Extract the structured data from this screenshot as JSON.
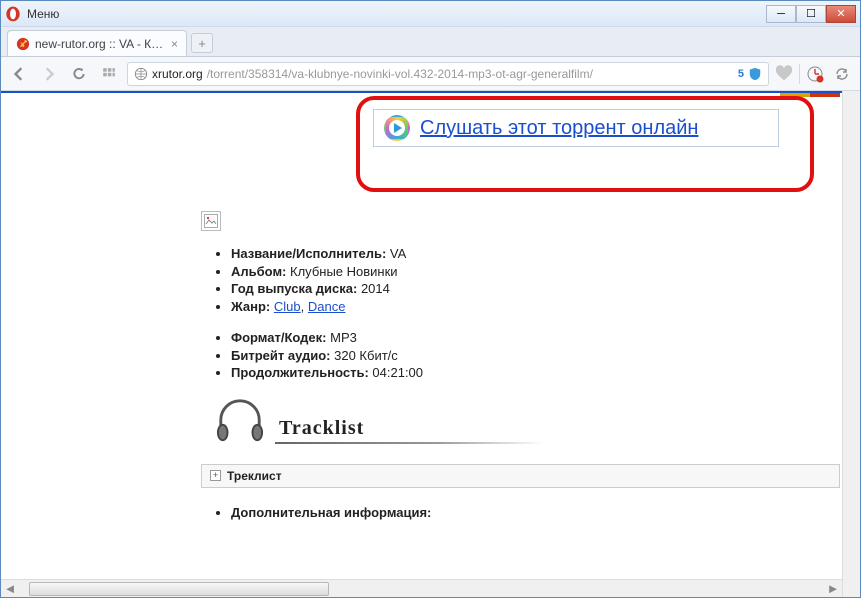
{
  "window": {
    "menu_label": "Меню"
  },
  "tab": {
    "title": "new-rutor.org :: VA - Клуб"
  },
  "address": {
    "host": "xrutor.org",
    "path": "/torrent/358314/va-klubnye-novinki-vol.432-2014-mp3-ot-agr-generalfilm/",
    "badge_count": "5"
  },
  "callout": {
    "listen_label": "Слушать этот торрент онлайн"
  },
  "info1": [
    {
      "label": "Название/Исполнитель:",
      "value": "VA"
    },
    {
      "label": "Альбом:",
      "value": "Клубные Новинки"
    },
    {
      "label": "Год выпуска диска:",
      "value": "2014"
    },
    {
      "label": "Жанр:",
      "links": [
        "Club",
        "Dance"
      ]
    }
  ],
  "info2": [
    {
      "label": "Формат/Кодек:",
      "value": "MP3"
    },
    {
      "label": "Битрейт аудио:",
      "value": "320 Кбит/с"
    },
    {
      "label": "Продолжительность:",
      "value": "04:21:00"
    }
  ],
  "tracklist_heading": "Tracklist",
  "expander": {
    "label": "Треклист"
  },
  "extra_info_label": "Дополнительная информация:"
}
